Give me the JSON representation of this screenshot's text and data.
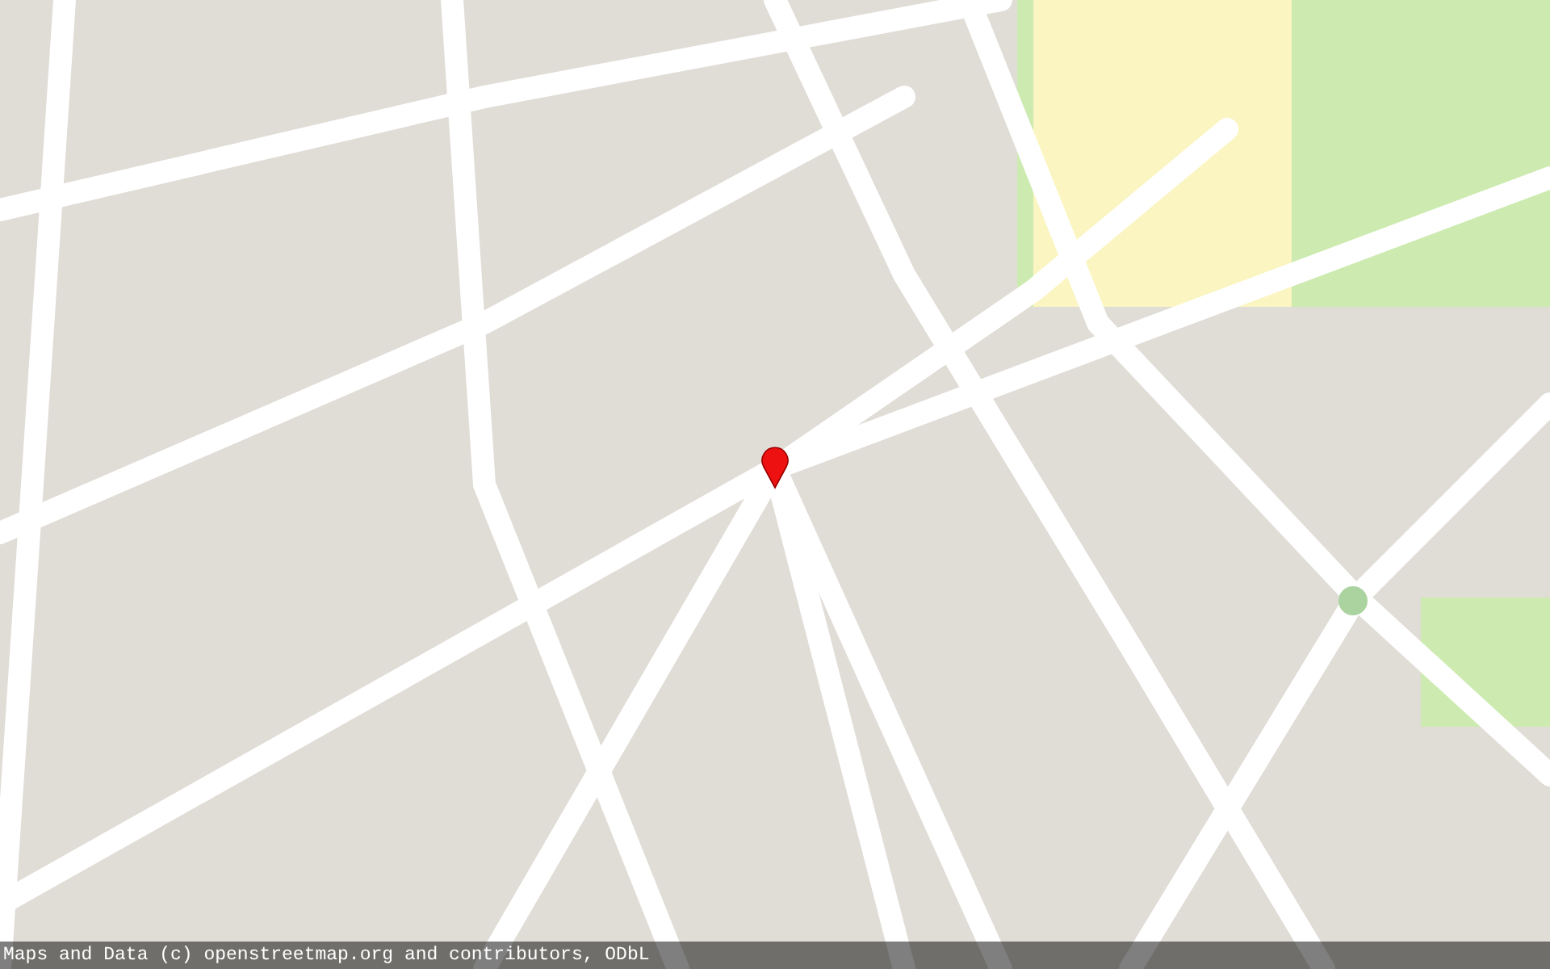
{
  "attribution_bar": {
    "text": "Maps and Data (c) openstreetmap.org and contributors, ODbL"
  }
}
